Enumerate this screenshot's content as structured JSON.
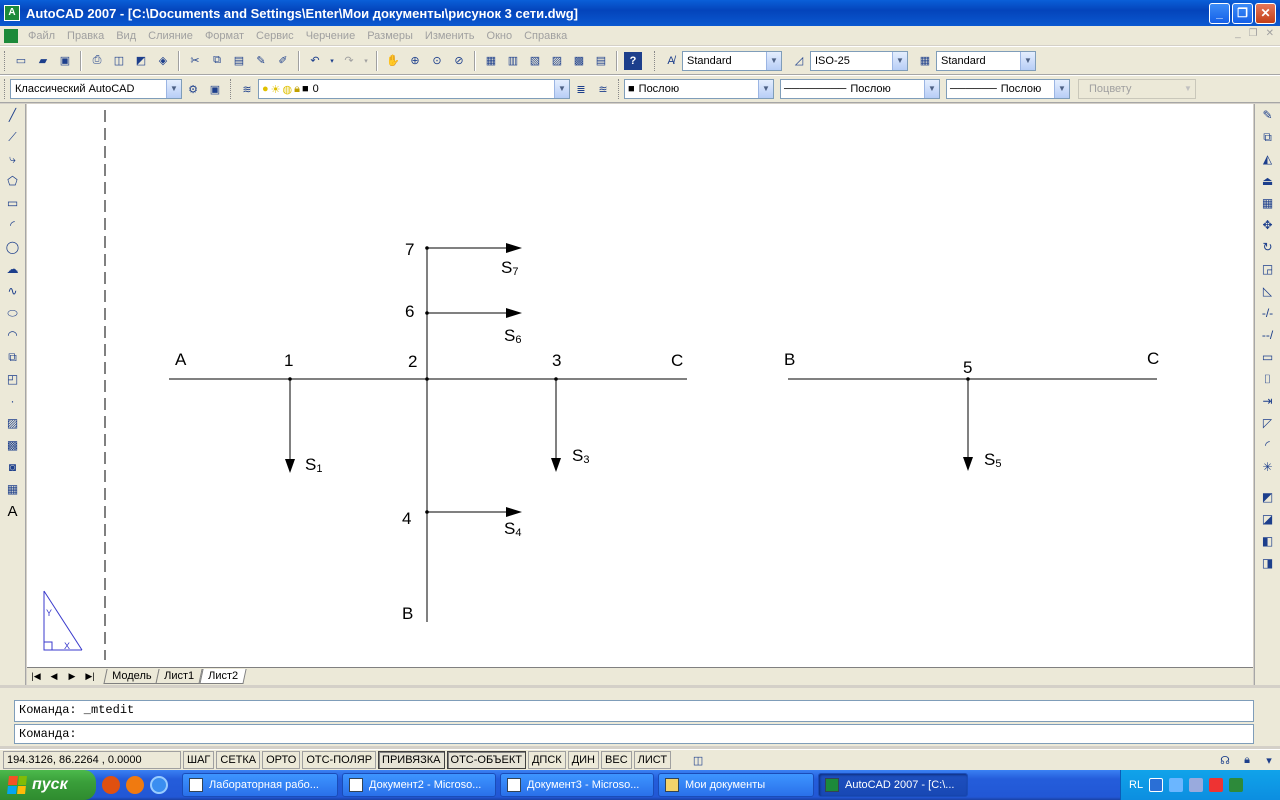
{
  "window": {
    "title": "AutoCAD 2007 - [C:\\Documents and Settings\\Enter\\Мои документы\\рисунок 3 сети.dwg]",
    "controls": [
      "_",
      "❐",
      "✕"
    ]
  },
  "menu": {
    "items": [
      "Файл",
      "Правка",
      "Вид",
      "Слияние",
      "Формат",
      "Сервис",
      "Черчение",
      "Размеры",
      "Изменить",
      "Окно",
      "Справка"
    ]
  },
  "toolbar1": {
    "text_style": "Standard",
    "dim_style": "ISO-25",
    "table_style": "Standard"
  },
  "toolbar2": {
    "workspace": "Классический AutoCAD",
    "layer": "0",
    "color": "Послою",
    "linetype": "Послою",
    "lineweight": "Послою",
    "plotstyle": "Поцвету"
  },
  "drawing": {
    "main_labels": {
      "A": "A",
      "n1": "1",
      "n2": "2",
      "n3": "3",
      "C1": "C",
      "n4": "4",
      "n6": "6",
      "n7": "7",
      "B1": "B",
      "B2": "B",
      "n5": "5",
      "C2": "C"
    },
    "loads": [
      {
        "label": "S",
        "sub": "1"
      },
      {
        "label": "S",
        "sub": "3"
      },
      {
        "label": "S",
        "sub": "4"
      },
      {
        "label": "S",
        "sub": "6"
      },
      {
        "label": "S",
        "sub": "7"
      },
      {
        "label": "S",
        "sub": "5"
      }
    ],
    "ucs": {
      "y": "Y",
      "x": "X"
    }
  },
  "layout_tabs": [
    "Модель",
    "Лист1",
    "Лист2"
  ],
  "active_tab": "Лист2",
  "command": {
    "history": "Команда: _mtedit",
    "prompt": "Команда:"
  },
  "status": {
    "coords": "194.3126, 86.2264 , 0.0000",
    "buttons": [
      "ШАГ",
      "СЕТКА",
      "ОРТО",
      "ОТС-ПОЛЯР",
      "ПРИВЯЗКА",
      "ОТС-ОБЪЕКТ",
      "ДПСК",
      "ДИН",
      "ВЕС",
      "ЛИСТ"
    ],
    "on_buttons": [
      "ПРИВЯЗКА",
      "ОТС-ОБЪЕКТ"
    ]
  },
  "taskbar": {
    "start": "пуск",
    "tasks": [
      "Лабораторная рабо...",
      "Документ2 - Microso...",
      "Документ3 - Microso...",
      "Мои документы",
      "AutoCAD 2007 - [C:\\..."
    ],
    "active_task": "AutoCAD 2007 - [C:\\...",
    "lang": "RL"
  }
}
